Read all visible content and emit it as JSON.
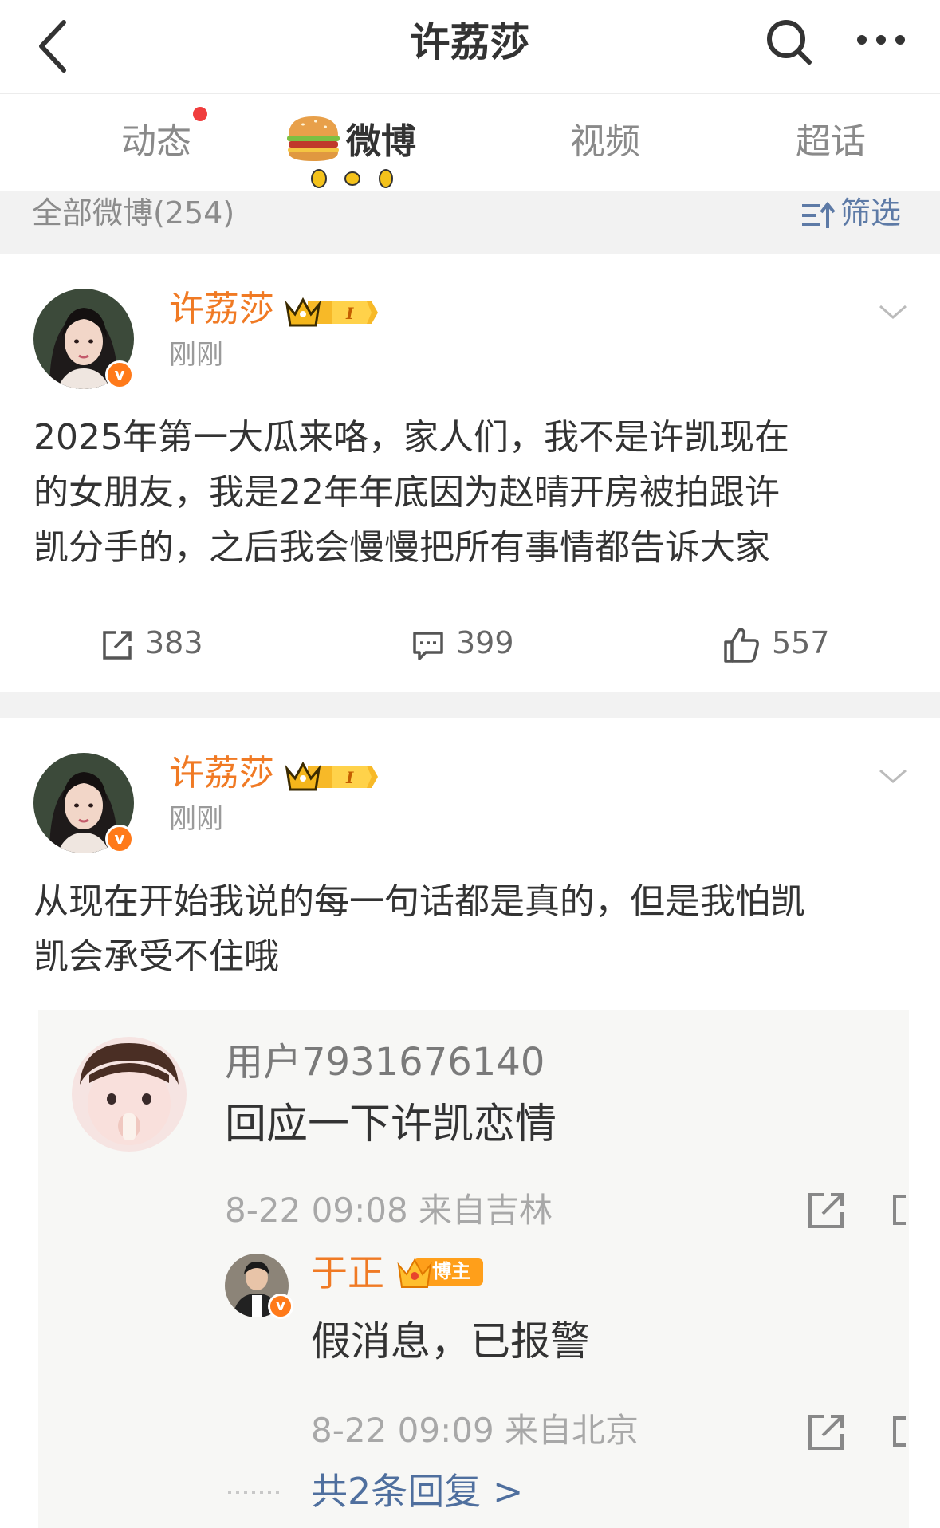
{
  "header": {
    "title": "许荔莎",
    "back_icon": "chevron-left-icon",
    "search_icon": "search-icon",
    "more_icon": "more-dots-icon"
  },
  "tabs": [
    {
      "label": "动态",
      "has_red_dot": true
    },
    {
      "label": "微博",
      "active": true,
      "decoration": "burger-icon"
    },
    {
      "label": "视频"
    },
    {
      "label": "超话"
    }
  ],
  "filter": {
    "count_label": "全部微博(254)",
    "filter_label": "筛选",
    "filter_icon": "sort-filter-icon"
  },
  "posts": [
    {
      "user": "许荔莎",
      "verified": "v",
      "time": "刚刚",
      "lines": [
        "2025年第一大瓜来咯，家人们，我不是许凯现在",
        "的女朋友，我是22年年底因为赵晴开房被拍跟许",
        "凯分手的，之后我会慢慢把所有事情都告诉大家"
      ],
      "actions": {
        "reposts": "383",
        "comments": "399",
        "likes": "557"
      }
    },
    {
      "user": "许荔莎",
      "verified": "v",
      "time": "刚刚",
      "lines": [
        "从现在开始我说的每一句话都是真的，但是我怕凯",
        "凯会承受不住哦"
      ],
      "embed": {
        "user": "用户7931676140",
        "text": "回应一下许凯恋情",
        "meta": "8-22 09:08 来自吉林",
        "reply": {
          "user": "于正",
          "badge": "博主",
          "verified": "v",
          "text": "假消息，已报警",
          "meta": "8-22 09:09 来自北京"
        },
        "more_replies": "共2条回复 >"
      }
    }
  ],
  "colors": {
    "username": "#f07a24",
    "link": "#4f6f9e",
    "badge": "#ff7a1a",
    "red_dot": "#f03d3d"
  }
}
